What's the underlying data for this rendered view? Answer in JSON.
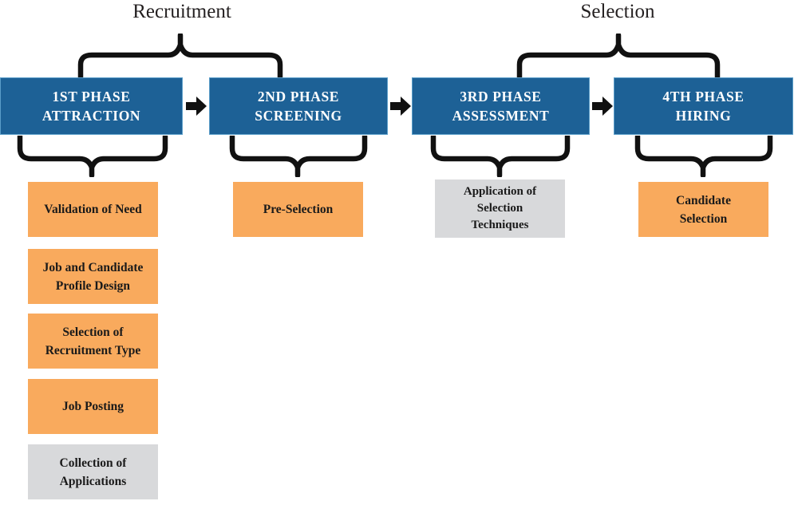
{
  "diagram": {
    "title_text_visible": false,
    "colors": {
      "phase_blue": "#1d6196",
      "phase_border": "#5b9ec9",
      "task_orange": "#f9aa5d",
      "task_gray": "#d8d9db",
      "brace_black": "#111111",
      "text_dark": "#231f20",
      "background": "#ffffff"
    },
    "groups": [
      {
        "id": "recruitment",
        "label": "Recruitment",
        "spans_phases": [
          1,
          2
        ]
      },
      {
        "id": "selection",
        "label": "Selection",
        "spans_phases": [
          3,
          4
        ]
      }
    ],
    "phases": [
      {
        "id": "phase-1",
        "line1": "1ST PHASE",
        "line2": "ATTRACTION",
        "tasks": [
          {
            "label_line1": "Validation of Need",
            "label_line2": "",
            "color": "orange"
          },
          {
            "label_line1": "Job and Candidate",
            "label_line2": "Profile Design",
            "color": "orange"
          },
          {
            "label_line1": "Selection of",
            "label_line2": "Recruitment Type",
            "color": "orange"
          },
          {
            "label_line1": "Job Posting",
            "label_line2": "",
            "color": "orange"
          },
          {
            "label_line1": "Collection of",
            "label_line2": "Applications",
            "color": "gray"
          }
        ]
      },
      {
        "id": "phase-2",
        "line1": "2ND PHASE",
        "line2": "SCREENING",
        "tasks": [
          {
            "label_line1": "Pre-Selection",
            "label_line2": "",
            "color": "orange"
          }
        ]
      },
      {
        "id": "phase-3",
        "line1": "3RD PHASE",
        "line2": "ASSESSMENT",
        "tasks": [
          {
            "label_line1": "Application of",
            "label_line2": "Selection",
            "label_line3": "Techniques",
            "color": "gray"
          }
        ]
      },
      {
        "id": "phase-4",
        "line1": "4TH PHASE",
        "line2": "HIRING",
        "tasks": [
          {
            "label_line1": "Candidate",
            "label_line2": "Selection",
            "color": "orange"
          }
        ]
      }
    ],
    "connectors": {
      "arrow_icon": "right-arrow-icon",
      "count": 3,
      "brace_icon_up": "curly-brace-up-icon",
      "brace_icon_down": "curly-brace-down-icon"
    }
  }
}
